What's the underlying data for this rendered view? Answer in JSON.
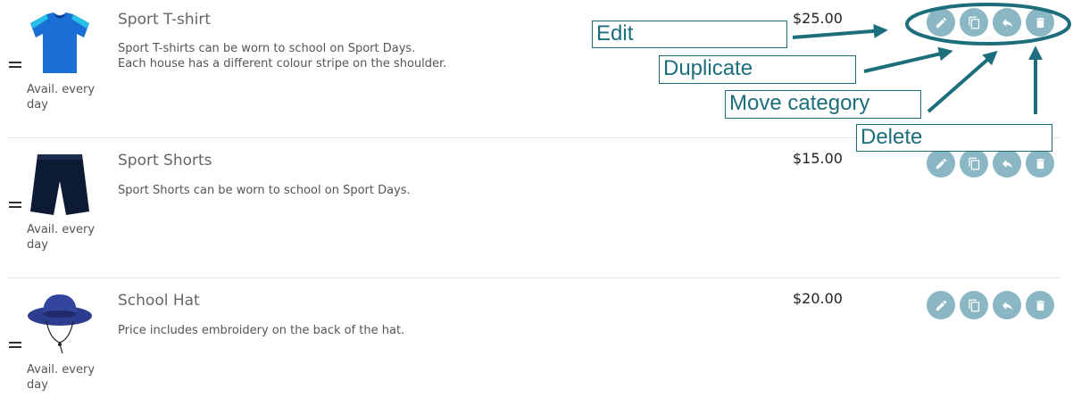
{
  "products": [
    {
      "name": "Sport T-shirt",
      "description_lines": [
        "Sport T-shirts can be worn to school on Sport Days.",
        "Each house has a different colour stripe on the shoulder."
      ],
      "price": "$25.00",
      "availability": "Avail. every day",
      "image_icon": "tshirt-image"
    },
    {
      "name": "Sport Shorts",
      "description_lines": [
        "Sport Shorts can be worn to school on Sport Days."
      ],
      "price": "$15.00",
      "availability": "Avail. every day",
      "image_icon": "shorts-image"
    },
    {
      "name": "School Hat",
      "description_lines": [
        "Price includes embroidery on the back of the hat."
      ],
      "price": "$20.00",
      "availability": "Avail. every day",
      "image_icon": "hat-image"
    }
  ],
  "actions": {
    "icons": [
      "pencil-icon",
      "copy-icon",
      "reply-arrow-icon",
      "trash-icon"
    ]
  },
  "annotations": {
    "edit": "Edit",
    "duplicate": "Duplicate",
    "move_category": "Move category",
    "delete": "Delete"
  },
  "colors": {
    "button_bg": "#8ab7c3",
    "annotation": "#1c6e7c",
    "tshirt": "#1a6fd6",
    "shorts": "#0c1a33",
    "hat": "#2c3c8f"
  }
}
